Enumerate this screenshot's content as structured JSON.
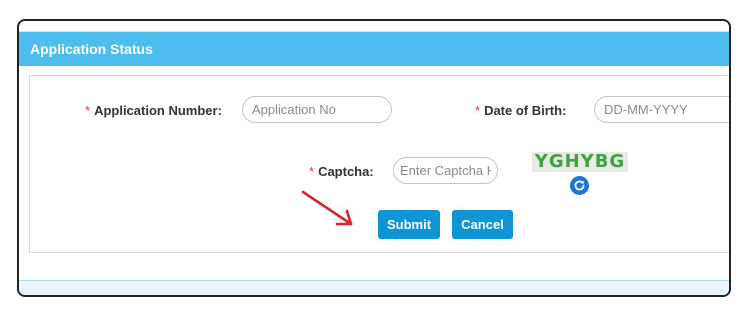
{
  "header": {
    "title": "Application Status"
  },
  "form": {
    "app_number": {
      "label": "Application Number:",
      "placeholder": "Application No",
      "required_mark": "*"
    },
    "dob": {
      "label": "Date of Birth:",
      "placeholder": "DD-MM-YYYY",
      "required_mark": "*"
    },
    "captcha": {
      "label": "Captcha:",
      "placeholder": "Enter Captcha H",
      "required_mark": "*",
      "image_text": "YGHYBG"
    }
  },
  "buttons": {
    "submit": "Submit",
    "cancel": "Cancel"
  },
  "colors": {
    "header": "#4dbdf0",
    "button": "#0e95d6",
    "required": "#e33333",
    "arrow": "#d9232e",
    "captcha_text": "#3da33d",
    "refresh": "#1a77d1"
  },
  "icons": {
    "refresh": "refresh-icon",
    "pointer": "arrow-pointer-icon"
  }
}
